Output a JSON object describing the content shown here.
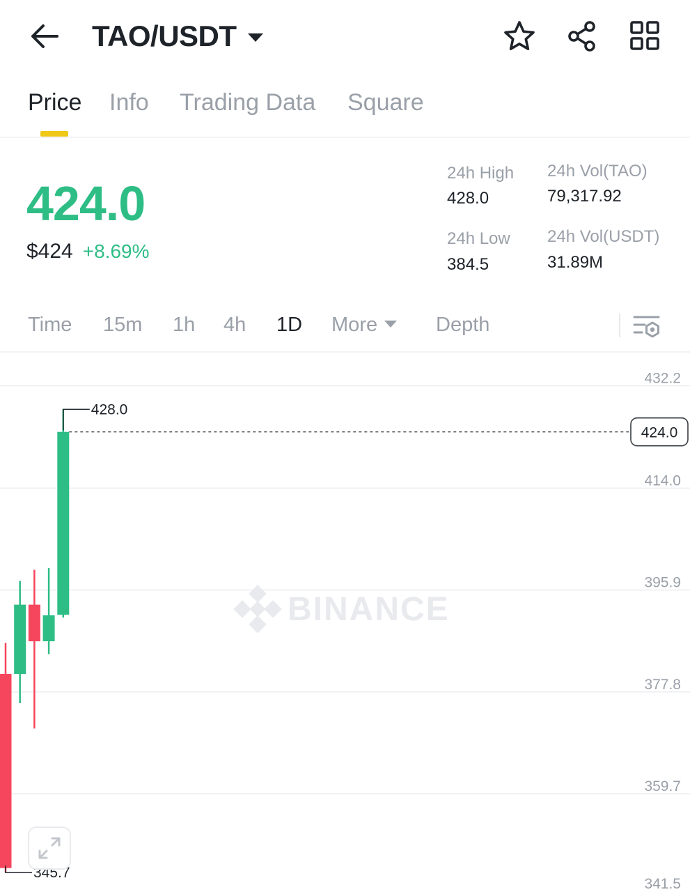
{
  "header": {
    "pair": "TAO/USDT",
    "icons": [
      "back-arrow-icon",
      "caret-down-icon",
      "star-icon",
      "share-icon",
      "grid-icon"
    ]
  },
  "tabs": [
    {
      "label": "Price",
      "active": true
    },
    {
      "label": "Info",
      "active": false
    },
    {
      "label": "Trading Data",
      "active": false
    },
    {
      "label": "Square",
      "active": false
    }
  ],
  "summary": {
    "last_price": "424.0",
    "usd_price": "$424",
    "change_pct": "+8.69%",
    "high_label": "24h High",
    "high_value": "428.0",
    "low_label": "24h Low",
    "low_value": "384.5",
    "vol_base_label": "24h Vol(TAO)",
    "vol_base_value": "79,317.92",
    "vol_quote_label": "24h Vol(USDT)",
    "vol_quote_value": "31.89M"
  },
  "intervals": {
    "items": [
      "Time",
      "15m",
      "1h",
      "4h",
      "1D"
    ],
    "active": "1D",
    "more_label": "More",
    "depth_label": "Depth"
  },
  "colors": {
    "up": "#2ebd85",
    "down": "#f6465d",
    "accent": "#f0c818",
    "text": "#1e2329",
    "muted": "#9aa0a8"
  },
  "chart_data": {
    "type": "candlestick",
    "interval": "1D",
    "ylim": [
      341.5,
      432.2
    ],
    "y_ticks": [
      "432.2",
      "414.0",
      "395.9",
      "377.8",
      "359.7",
      "341.5"
    ],
    "watermark": "BINANCE",
    "current_price_label": "424.0",
    "high_marker_label": "428.0",
    "low_marker_label": "345.7",
    "candles": [
      {
        "open": 381,
        "high": 386.5,
        "low": 345.7,
        "close": 346.5
      },
      {
        "open": 381,
        "high": 397.5,
        "low": 375.8,
        "close": 393.3
      },
      {
        "open": 393.3,
        "high": 399.5,
        "low": 371.3,
        "close": 386.8
      },
      {
        "open": 386.8,
        "high": 399.8,
        "low": 384.5,
        "close": 391.4
      },
      {
        "open": 391.5,
        "high": 428.0,
        "low": 391.0,
        "close": 424.0
      }
    ]
  }
}
